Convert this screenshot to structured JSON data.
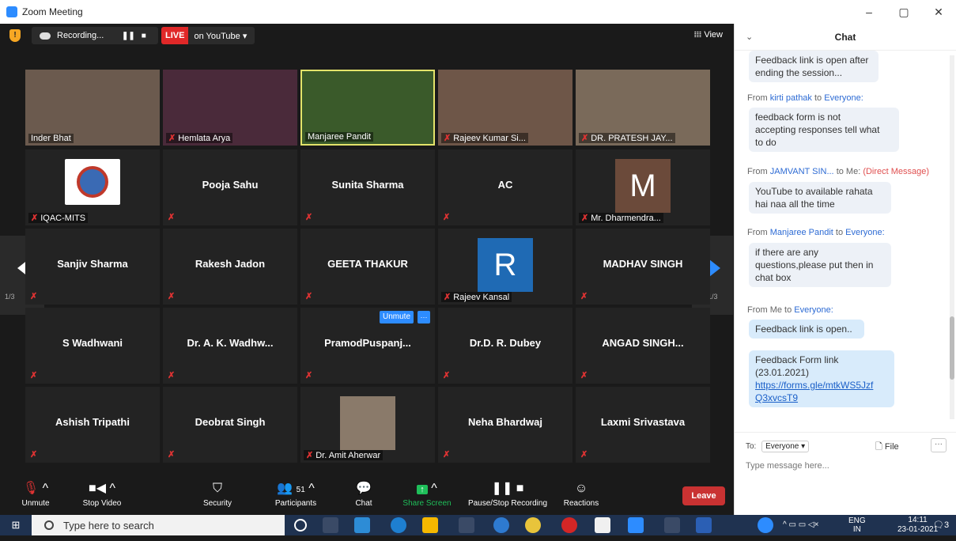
{
  "window": {
    "title": "Zoom Meeting",
    "min": "–",
    "max": "▢",
    "close": "✕"
  },
  "topbar": {
    "recording_label": "Recording...",
    "pause_icon": "❚❚",
    "stop_icon": "■",
    "live_label": "LIVE",
    "stream_label": "on YouTube ▾",
    "view_label": "𝍖 View",
    "shield_glyph": "!"
  },
  "tiles": [
    {
      "name": "Inder Bhat",
      "kind": "video",
      "bg": "#6b5a4e"
    },
    {
      "name": "Hemlata Arya",
      "kind": "video",
      "muted": true,
      "bg": "#4a2a3a"
    },
    {
      "name": "Manjaree Pandit",
      "kind": "video",
      "active": true,
      "bg": "#3a5a2a"
    },
    {
      "name": "Rajeev Kumar Si...",
      "kind": "video",
      "muted": true,
      "bg": "#6e5648"
    },
    {
      "name": "DR. PRATESH JAY...",
      "kind": "video",
      "muted": true,
      "bg": "#7a6a5a"
    },
    {
      "name": "IQAC-MITS",
      "kind": "logo",
      "muted": true
    },
    {
      "name": "Pooja Sahu",
      "kind": "name",
      "muted": true
    },
    {
      "name": "Sunita Sharma",
      "kind": "name",
      "muted": true
    },
    {
      "name": "AC",
      "kind": "name",
      "muted": true
    },
    {
      "name": "Mr. Dharmendra...",
      "kind": "avatar",
      "letter": "M",
      "avatar_bg": "#6b4a3a",
      "muted": true
    },
    {
      "name": "Sanjiv Sharma",
      "kind": "name",
      "muted": true
    },
    {
      "name": "Rakesh Jadon",
      "kind": "name",
      "muted": true
    },
    {
      "name": "GEETA THAKUR",
      "kind": "name",
      "muted": true
    },
    {
      "name": "Rajeev Kansal",
      "kind": "avatar",
      "letter": "R",
      "avatar_bg": "#1f6ab4",
      "muted": true
    },
    {
      "name": "MADHAV SINGH",
      "kind": "name",
      "muted": true
    },
    {
      "name": "S Wadhwani",
      "kind": "name",
      "muted": true
    },
    {
      "name": "Dr. A. K. Wadhw...",
      "kind": "name",
      "muted": true
    },
    {
      "name": "PramodPuspanj...",
      "kind": "name",
      "muted": true,
      "hover": true
    },
    {
      "name": "Dr.D. R. Dubey",
      "kind": "name",
      "muted": true
    },
    {
      "name": "ANGAD SINGH...",
      "kind": "name",
      "muted": true
    },
    {
      "name": "Ashish Tripathi",
      "kind": "name",
      "muted": true
    },
    {
      "name": "Deobrat Singh",
      "kind": "name",
      "muted": true
    },
    {
      "name": "Dr. Amit Aherwar",
      "kind": "photo",
      "muted": true
    },
    {
      "name": "Neha Bhardwaj",
      "kind": "name",
      "muted": true
    },
    {
      "name": "Laxmi Srivastava",
      "kind": "name",
      "muted": true
    }
  ],
  "hover_controls": {
    "unmute": "Unmute",
    "more": "···"
  },
  "pager": {
    "left_label": "1/3",
    "right_label": "1/3"
  },
  "toolbar": {
    "unmute": "Unmute",
    "stop_video": "Stop Video",
    "security": "Security",
    "participants": "Participants",
    "participants_count": "51",
    "chat": "Chat",
    "share_screen": "Share Screen",
    "pause_stop_recording": "Pause/Stop Recording",
    "reactions": "Reactions",
    "leave": "Leave"
  },
  "chat": {
    "title": "Chat",
    "messages": [
      {
        "text_lines": [
          "Feedback link is open after",
          "ending the session..."
        ]
      },
      {
        "from_prefix": "From",
        "from": "kirti pathak",
        "to_prefix": "to",
        "to": "Everyone:",
        "text_lines": [
          "feedback form is not",
          "accepting responses tell what",
          "to do"
        ]
      },
      {
        "from_prefix": "From",
        "from": "JAMVANT SIN...",
        "to_prefix": "to Me:",
        "dm": "(Direct Message)",
        "text_lines": [
          "YouTube to available rahata",
          "hai naa all the time"
        ]
      },
      {
        "from_prefix": "From",
        "from": "Manjaree Pandit",
        "to_prefix": "to",
        "to": "Everyone:",
        "text_lines": [
          "if there are any",
          "questions,please put then in",
          "chat box"
        ]
      },
      {
        "from_prefix": "From Me to",
        "to": "Everyone:",
        "text_lines": [
          "Feedback link is open.."
        ]
      },
      {
        "text_lines": [
          "Feedback Form link",
          "(23.01.2021)"
        ],
        "link_lines": [
          "https://forms.gle/mtkWS5Jzf",
          "Q3xvcsT9"
        ]
      }
    ],
    "to_label": "To:",
    "to_value": "Everyone ▾",
    "file_label": "🗋 File",
    "more_label": "···",
    "placeholder": "Type message here..."
  },
  "taskbar": {
    "search_placeholder": "Type here to search",
    "lang": "ENG",
    "region": "IN",
    "time": "14:11",
    "date": "23-01-2021",
    "notif_count": "3"
  },
  "colors": {
    "accent": "#2d8cff",
    "live": "#e02828",
    "leave": "#c93232",
    "muted": "#e03333"
  }
}
